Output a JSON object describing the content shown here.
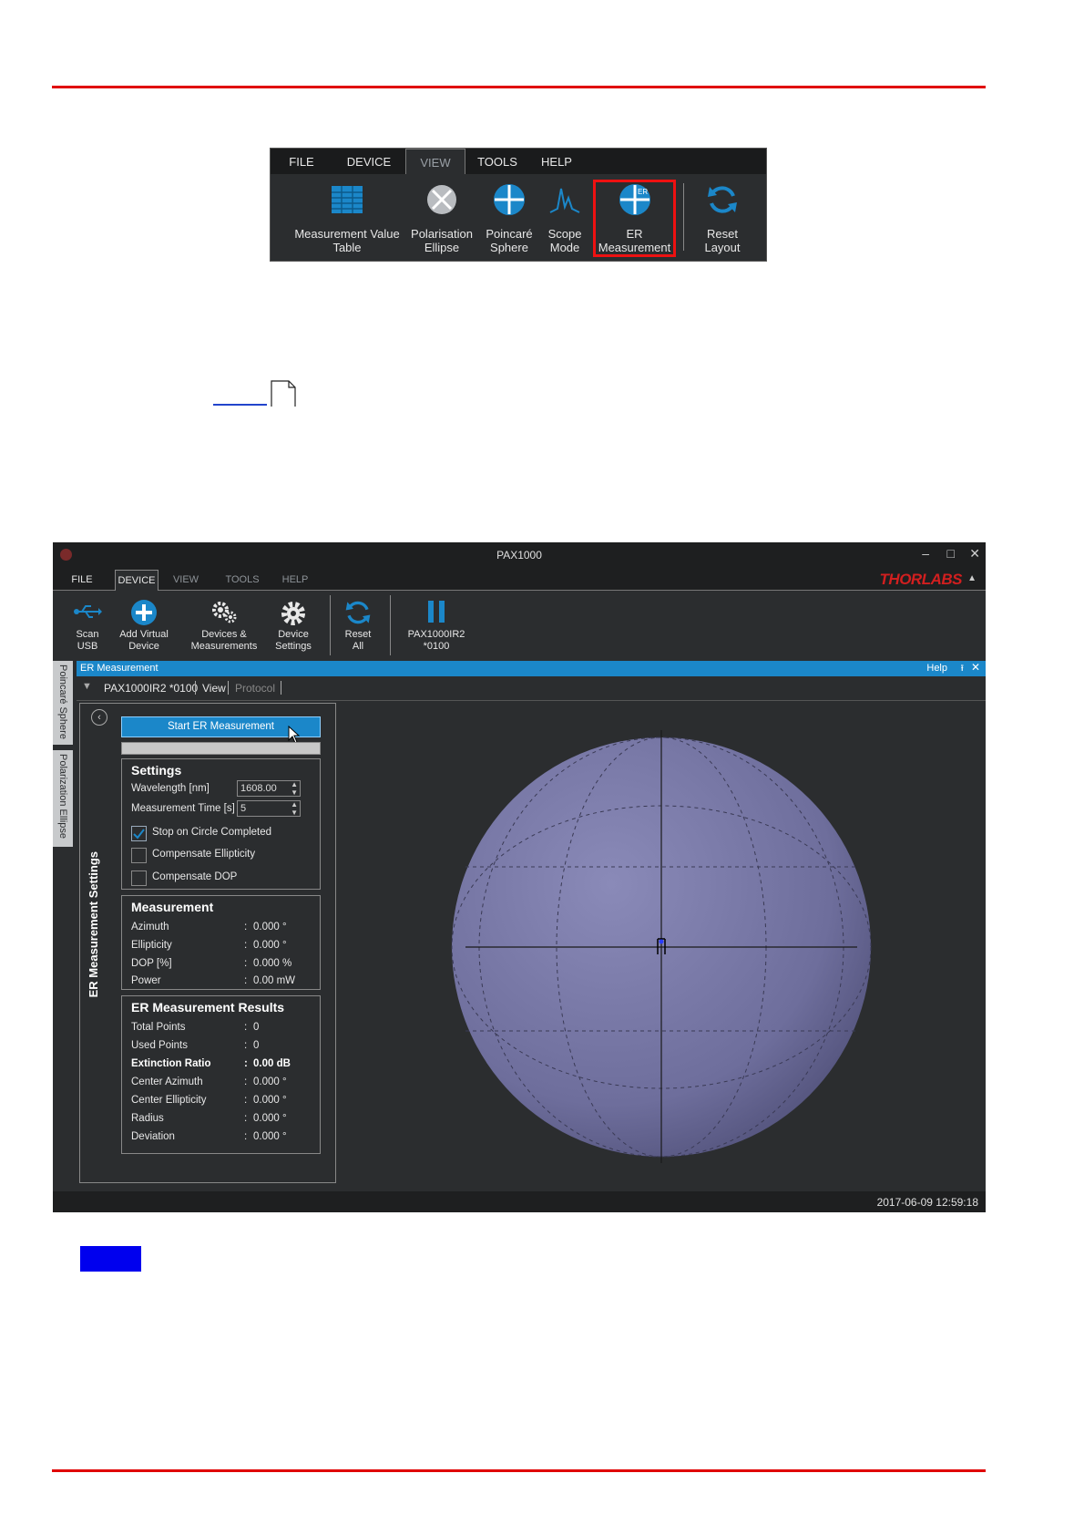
{
  "ribbon": {
    "tabs": [
      "FILE",
      "DEVICE",
      "VIEW",
      "TOOLS",
      "HELP"
    ],
    "buttons": [
      {
        "label": "Measurement Value\nTable",
        "icon": "table-icon"
      },
      {
        "label": "Polarisation\nEllipse",
        "icon": "ellipse-icon"
      },
      {
        "label": "Poincaré\nSphere",
        "icon": "sphere-icon"
      },
      {
        "label": "Scope\nMode",
        "icon": "scope-icon"
      },
      {
        "label": "ER\nMeasurement",
        "icon": "er-icon",
        "highlighted": true
      },
      {
        "label": "Reset\nLayout",
        "icon": "reset-icon"
      }
    ]
  },
  "app": {
    "title": "PAX1000",
    "menu": [
      "FILE",
      "DEVICE",
      "VIEW",
      "TOOLS",
      "HELP"
    ],
    "brand": "THORLABS",
    "toolbar": [
      {
        "label": "Scan\nUSB",
        "icon": "usb-icon"
      },
      {
        "label": "Add Virtual\nDevice",
        "icon": "add-icon"
      },
      {
        "label": "Devices &\nMeasurements",
        "icon": "gears-icon"
      },
      {
        "label": "Device\nSettings",
        "icon": "gear-icon"
      },
      {
        "label": "Reset\nAll",
        "icon": "reset-icon"
      },
      {
        "label": "PAX1000IR2\n*0100",
        "icon": "pause-icon"
      }
    ],
    "side_tabs": [
      "Poincaré Sphere",
      "Polarization Ellipse"
    ],
    "panel": {
      "title": "ER Measurement",
      "help": "Help",
      "pin": "⭱",
      "close": "✕",
      "device": "PAX1000IR2 *0100",
      "view": "View",
      "protocol": "Protocol",
      "collapse": "▼"
    },
    "settings_panel": {
      "vertical_label": "ER Measurement Settings",
      "start_button": "Start ER Measurement",
      "settings_title": "Settings",
      "wavelength_label": "Wavelength [nm]",
      "wavelength_value": "1608.00",
      "time_label": "Measurement Time [s]",
      "time_value": "5",
      "checkboxes": [
        {
          "label": "Stop on Circle Completed",
          "checked": true
        },
        {
          "label": "Compensate Ellipticity",
          "checked": false
        },
        {
          "label": "Compensate DOP",
          "checked": false
        }
      ],
      "measurement_title": "Measurement",
      "measurement": [
        {
          "k": "Azimuth",
          "v": "0.000 °"
        },
        {
          "k": "Ellipticity",
          "v": "0.000 °"
        },
        {
          "k": "DOP [%]",
          "v": "0.000 %"
        },
        {
          "k": "Power",
          "v": "0.00 mW"
        }
      ],
      "results_title": "ER Measurement Results",
      "results": [
        {
          "k": "Total Points",
          "v": "0"
        },
        {
          "k": "Used Points",
          "v": "0"
        },
        {
          "k": "Extinction Ratio",
          "v": "0.00 dB",
          "bold": true
        },
        {
          "k": "Center Azimuth",
          "v": "0.000 °"
        },
        {
          "k": "Center Ellipticity",
          "v": "0.000 °"
        },
        {
          "k": "Radius",
          "v": "0.000 °"
        },
        {
          "k": "Deviation",
          "v": "0.000 °"
        }
      ]
    },
    "status_timestamp": "2017-06-09 12:59:18"
  }
}
